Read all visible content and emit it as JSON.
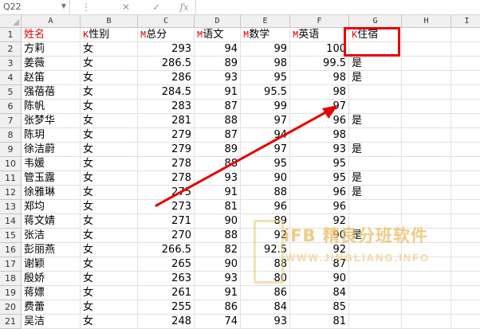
{
  "formula_bar": {
    "name_box": "Q22",
    "cancel_icon": "✕",
    "enter_icon": "✓",
    "fx_label": "fx"
  },
  "columns": [
    "A",
    "B",
    "C",
    "D",
    "E",
    "F",
    "G",
    "H",
    "I"
  ],
  "header_row": {
    "row_number": "1",
    "cells": [
      {
        "marker": "",
        "text": "姓名",
        "red": true
      },
      {
        "marker": "K",
        "text": "性别",
        "red": false
      },
      {
        "marker": "M",
        "text": "总分",
        "red": false
      },
      {
        "marker": "M",
        "text": "语文",
        "red": false
      },
      {
        "marker": "M",
        "text": "数学",
        "red": false
      },
      {
        "marker": "M",
        "text": "英语",
        "red": false
      },
      {
        "marker": "K",
        "text": "住宿",
        "red": false
      }
    ]
  },
  "rows": [
    {
      "n": "2",
      "name": "方莉",
      "sex": "女",
      "total": "293",
      "cn": "94",
      "math": "99",
      "en": "100",
      "dorm": ""
    },
    {
      "n": "3",
      "name": "姜薇",
      "sex": "女",
      "total": "286.5",
      "cn": "89",
      "math": "98",
      "en": "99.5",
      "dorm": "是"
    },
    {
      "n": "4",
      "name": "赵笛",
      "sex": "女",
      "total": "286",
      "cn": "93",
      "math": "95",
      "en": "98",
      "dorm": "是"
    },
    {
      "n": "5",
      "name": "强蓓蓓",
      "sex": "女",
      "total": "284.5",
      "cn": "91",
      "math": "95.5",
      "en": "98",
      "dorm": ""
    },
    {
      "n": "6",
      "name": "陈帆",
      "sex": "女",
      "total": "283",
      "cn": "87",
      "math": "99",
      "en": "97",
      "dorm": ""
    },
    {
      "n": "7",
      "name": "张梦华",
      "sex": "女",
      "total": "281",
      "cn": "88",
      "math": "97",
      "en": "96",
      "dorm": "是"
    },
    {
      "n": "8",
      "name": "陈玥",
      "sex": "女",
      "total": "279",
      "cn": "87",
      "math": "94",
      "en": "98",
      "dorm": ""
    },
    {
      "n": "9",
      "name": "徐洁蔚",
      "sex": "女",
      "total": "279",
      "cn": "89",
      "math": "97",
      "en": "93",
      "dorm": "是"
    },
    {
      "n": "10",
      "name": "韦媛",
      "sex": "女",
      "total": "278",
      "cn": "88",
      "math": "95",
      "en": "95",
      "dorm": ""
    },
    {
      "n": "11",
      "name": "管玉露",
      "sex": "女",
      "total": "278",
      "cn": "93",
      "math": "90",
      "en": "95",
      "dorm": "是"
    },
    {
      "n": "12",
      "name": "徐雅琳",
      "sex": "女",
      "total": "275",
      "cn": "91",
      "math": "88",
      "en": "96",
      "dorm": "是"
    },
    {
      "n": "13",
      "name": "郑均",
      "sex": "女",
      "total": "273",
      "cn": "81",
      "math": "96",
      "en": "96",
      "dorm": ""
    },
    {
      "n": "14",
      "name": "蒋文婧",
      "sex": "女",
      "total": "271",
      "cn": "90",
      "math": "89",
      "en": "92",
      "dorm": ""
    },
    {
      "n": "15",
      "name": "张洁",
      "sex": "女",
      "total": "270",
      "cn": "88",
      "math": "92",
      "en": "90",
      "dorm": "是"
    },
    {
      "n": "16",
      "name": "彭丽燕",
      "sex": "女",
      "total": "266.5",
      "cn": "82",
      "math": "92.5",
      "en": "92",
      "dorm": ""
    },
    {
      "n": "17",
      "name": "谢颖",
      "sex": "女",
      "total": "265",
      "cn": "90",
      "math": "88",
      "en": "87",
      "dorm": ""
    },
    {
      "n": "18",
      "name": "殷娇",
      "sex": "女",
      "total": "263",
      "cn": "93",
      "math": "80",
      "en": "90",
      "dorm": ""
    },
    {
      "n": "19",
      "name": "蒋嫖",
      "sex": "女",
      "total": "261",
      "cn": "91",
      "math": "86",
      "en": "84",
      "dorm": ""
    },
    {
      "n": "20",
      "name": "费蕾",
      "sex": "女",
      "total": "255",
      "cn": "86",
      "math": "84",
      "en": "85",
      "dorm": ""
    },
    {
      "n": "21",
      "name": "吴洁",
      "sex": "女",
      "total": "248",
      "cn": "74",
      "math": "93",
      "en": "81",
      "dorm": ""
    }
  ],
  "watermark": {
    "title": "iFB 精良分班软件",
    "url": "WWW.JINGLIANG.INFO"
  },
  "colors": {
    "annotation_red": "#e60000",
    "header_marker_red": "#e00000"
  }
}
